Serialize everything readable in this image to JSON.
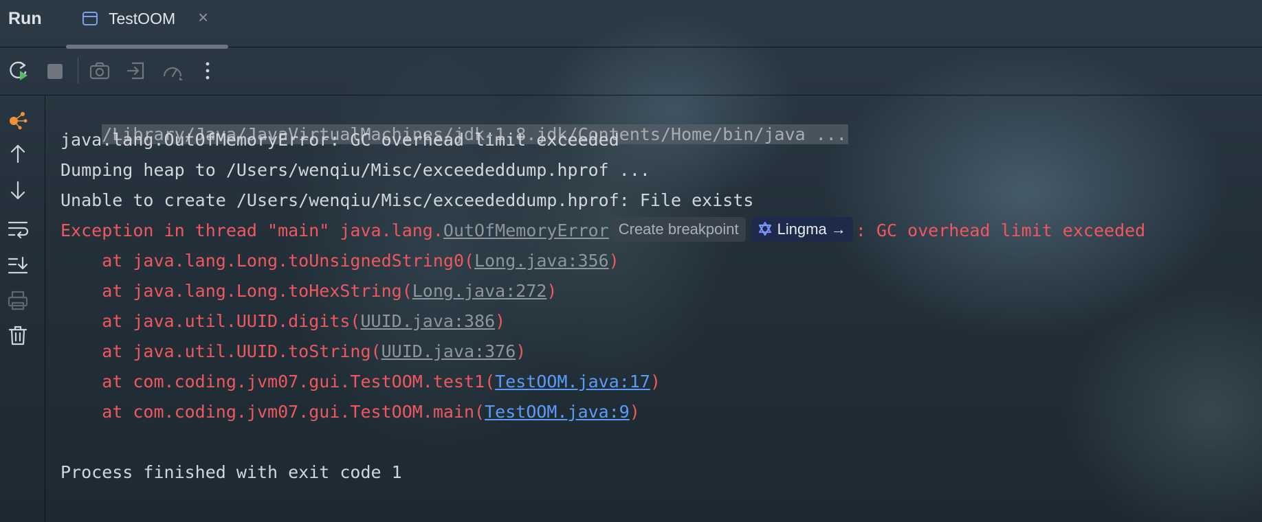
{
  "window": {
    "panel_title": "Run",
    "tab": {
      "label": "TestOOM",
      "icon": "console-window-icon",
      "close_icon": "close-icon"
    }
  },
  "toolbar": {
    "buttons": [
      {
        "name": "rerun-button",
        "icon": "rerun-icon"
      },
      {
        "name": "stop-button",
        "icon": "stop-icon"
      },
      {
        "name": "dump-threads-button",
        "icon": "camera-icon"
      },
      {
        "name": "exit-button",
        "icon": "exit-icon"
      },
      {
        "name": "profiler-button",
        "icon": "gauge-icon"
      },
      {
        "name": "more-options-button",
        "icon": "more-vertical-icon"
      }
    ]
  },
  "sidebar": {
    "buttons": [
      {
        "name": "ai-assistant-button",
        "icon": "ai-nodes-icon"
      },
      {
        "name": "scroll-up-button",
        "icon": "arrow-up-icon"
      },
      {
        "name": "scroll-down-button",
        "icon": "arrow-down-icon"
      },
      {
        "name": "soft-wrap-button",
        "icon": "soft-wrap-icon"
      },
      {
        "name": "scroll-to-end-button",
        "icon": "scroll-to-end-icon"
      },
      {
        "name": "print-button",
        "icon": "print-icon"
      },
      {
        "name": "clear-all-button",
        "icon": "trash-icon"
      }
    ]
  },
  "console": {
    "command": "/Library/Java/JavaVirtualMachines/jdk-1.8.jdk/Contents/Home/bin/java ...",
    "line1": "java.lang.OutOfMemoryError: GC overhead limit exceeded",
    "line2": "Dumping heap to /Users/wenqiu/Misc/exceededdump.hprof ...",
    "line3": "Unable to create /Users/wenqiu/Misc/exceededdump.hprof: File exists",
    "exception": {
      "prefix": "Exception in thread \"main\" java.lang.",
      "class_link": "OutOfMemoryError",
      "create_breakpoint": "Create breakpoint",
      "lingma": "Lingma →",
      "suffix": ": GC overhead limit exceeded"
    },
    "stack": [
      {
        "prefix": "    at java.lang.Long.toUnsignedString0(",
        "link": "Long.java:356",
        "suffix": ")"
      },
      {
        "prefix": "    at java.lang.Long.toHexString(",
        "link": "Long.java:272",
        "suffix": ")"
      },
      {
        "prefix": "    at java.util.UUID.digits(",
        "link": "UUID.java:386",
        "suffix": ")"
      },
      {
        "prefix": "    at java.util.UUID.toString(",
        "link": "UUID.java:376",
        "suffix": ")"
      },
      {
        "prefix": "    at com.coding.jvm07.gui.TestOOM.test1(",
        "link": "TestOOM.java:17",
        "suffix": ")"
      },
      {
        "prefix": "    at com.coding.jvm07.gui.TestOOM.main(",
        "link": "TestOOM.java:9",
        "suffix": ")"
      }
    ],
    "finish": "Process finished with exit code 1"
  },
  "colors": {
    "error": "#f0575f",
    "link_blue": "#5b9bf8",
    "link_gray": "#8e959d",
    "text": "#d2d6db",
    "ai_accent": "#f5903a"
  }
}
